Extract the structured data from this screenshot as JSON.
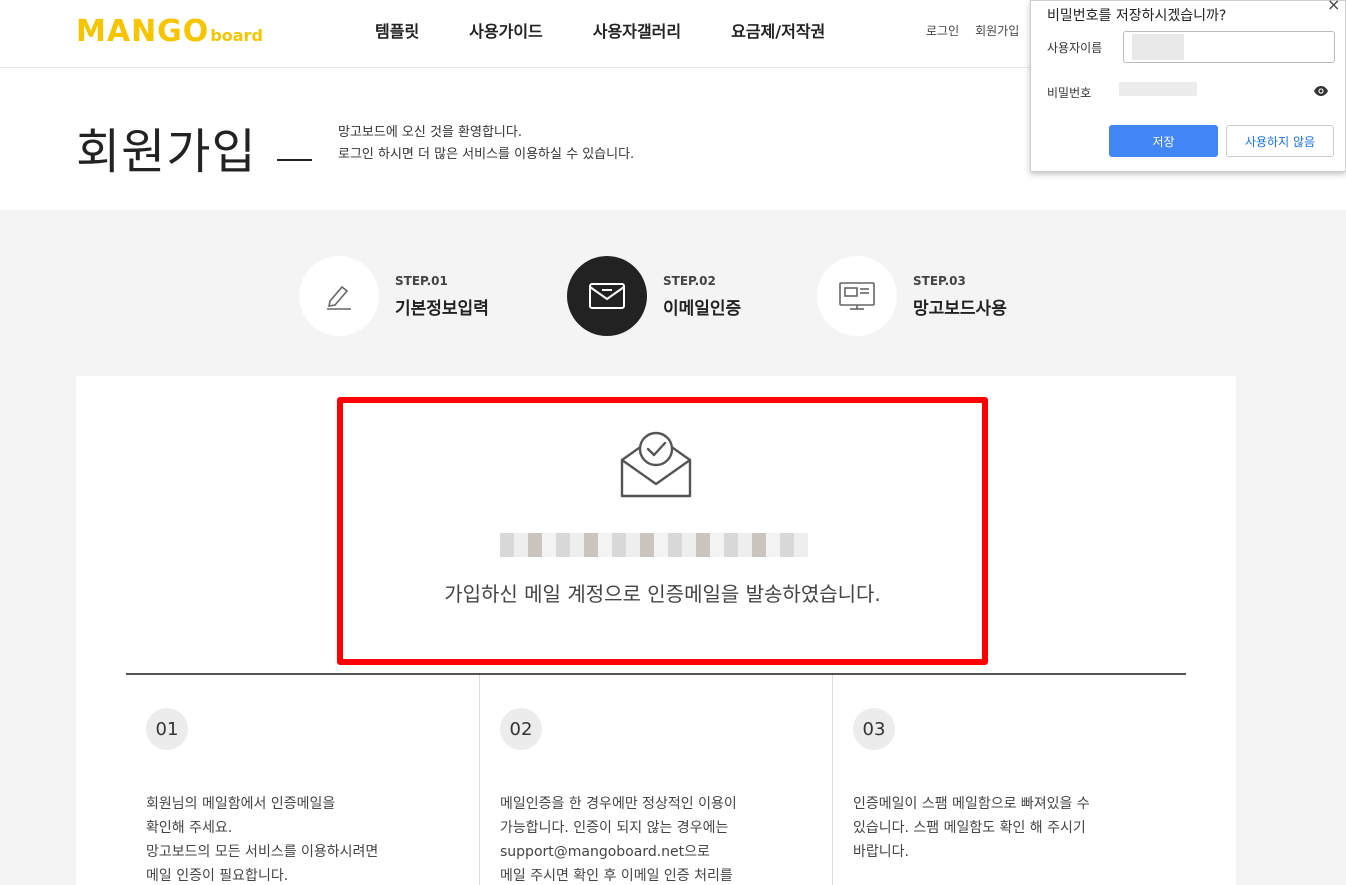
{
  "brand": {
    "logo_main": "MANGO",
    "logo_sub": "board",
    "color": "#f7c500"
  },
  "nav": [
    {
      "label": "템플릿"
    },
    {
      "label": "사용가이드"
    },
    {
      "label": "사용자갤러리"
    },
    {
      "label": "요금제/저작권"
    }
  ],
  "util": {
    "login": "로그인",
    "signup": "회원가입"
  },
  "page": {
    "title": "회원가입",
    "welcome_line1": "망고보드에 오신 것을 환영합니다.",
    "welcome_line2": "로그인 하시면 더 많은 서비스를 이용하실 수 있습니다."
  },
  "steps": [
    {
      "num": "STEP.01",
      "label": "기본정보입력",
      "icon": "pen-icon"
    },
    {
      "num": "STEP.02",
      "label": "이메일인증",
      "icon": "envelope-icon",
      "active": true
    },
    {
      "num": "STEP.03",
      "label": "망고보드사용",
      "icon": "monitor-icon"
    }
  ],
  "verify": {
    "icon": "mail-check-icon",
    "message": "가입하신 메일 계정으로 인증메일을 발송하였습니다."
  },
  "info": [
    {
      "num": "01",
      "text": "회원님의 메일함에서 인증메일을\n확인해 주세요.\n망고보드의 모든 서비스를 이용하시려면\n메일 인증이 필요합니다."
    },
    {
      "num": "02",
      "text": "메일인증을 한 경우에만 정상적인 이용이\n가능합니다. 인증이 되지 않는 경우에는\nsupport@mangoboard.net으로\n메일 주시면 확인 후 이메일 인증 처리를"
    },
    {
      "num": "03",
      "text": "인증메일이 스팸 메일함으로 빠져있을 수\n있습니다. 스팸 메일함도 확인 해 주시기\n바랍니다."
    }
  ],
  "password_dialog": {
    "title": "비밀번호를 저장하시겠습니까?",
    "username_label": "사용자이름",
    "password_label": "비밀번호",
    "save_button": "저장",
    "never_button": "사용하지 않음",
    "close": "×",
    "accent": "#4285f4"
  }
}
